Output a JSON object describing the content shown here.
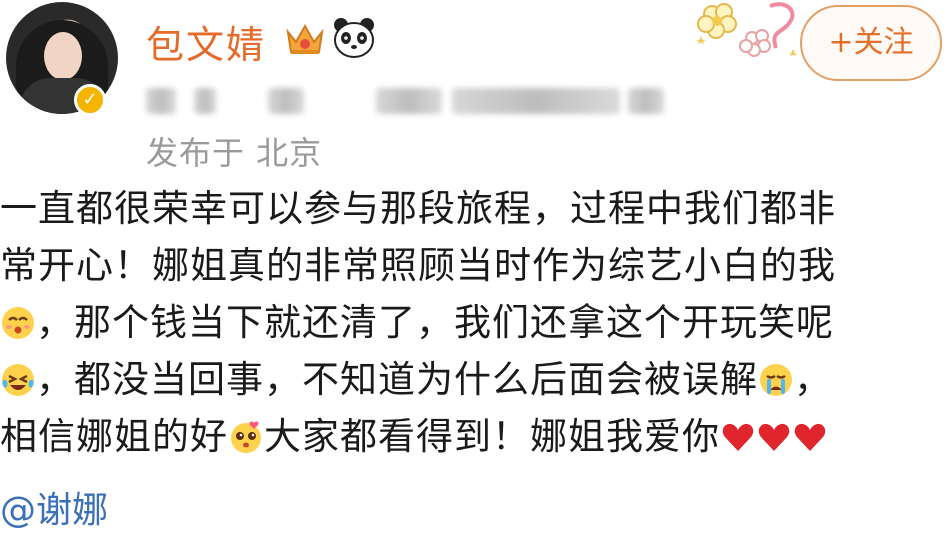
{
  "header": {
    "username": "包文婧",
    "follow_label": "+关注",
    "location": "发布于 北京"
  },
  "post": {
    "line1": "一直都很荣幸可以参与那段旅程，过程中我们都非",
    "line2": "常开心！娜姐真的非常照顾当时作为综艺小白的我",
    "line3": "，那个钱当下就还清了，我们还拿这个开玩笑呢",
    "line4a": "，都没当回事，不知道为什么后面会被误解",
    "line4b": "，",
    "line5a": "相信娜姐的好",
    "line5b": "大家都看得到！娜姐我爱你",
    "mention": "@谢娜"
  },
  "icons": {
    "verified": "verified-badge-icon",
    "crown": "crown-icon",
    "panda": "panda-icon",
    "emoji_smile": "grin-emoji-icon",
    "emoji_laugh": "laugh-cry-emoji-icon",
    "emoji_cry": "crying-emoji-icon",
    "emoji_heart_eyes": "adoring-emoji-icon",
    "heart": "red-heart-icon"
  },
  "colors": {
    "username": "#e66b2a",
    "follow": "#e2702a",
    "mention": "#3b6fb6",
    "location": "#9a9a9a"
  }
}
